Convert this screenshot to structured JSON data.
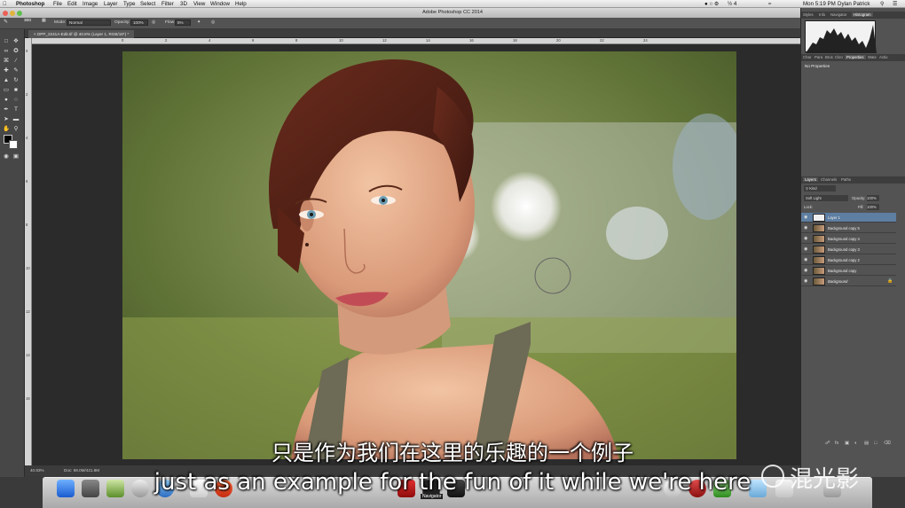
{
  "menubar": {
    "app_name": "Photoshop",
    "items": [
      "File",
      "Edit",
      "Image",
      "Layer",
      "Type",
      "Select",
      "Filter",
      "3D",
      "View",
      "Window",
      "Help"
    ],
    "battery": "½ 4",
    "clock": "Mon 5:19 PM",
    "user": "Dylan Patrick"
  },
  "window": {
    "title": "Adobe Photoshop CC 2014"
  },
  "options": {
    "brush_size": "300",
    "mode_label": "Mode:",
    "mode_value": "Normal",
    "opacity_label": "Opacity:",
    "opacity_value": "100%",
    "flow_label": "Flow:",
    "flow_value": "5%"
  },
  "document": {
    "tab_label": "DPP_2241A-Edit.tif @ 40.8% (Layer 1, RGB/16*) *",
    "zoom": "40.83%",
    "doc_size": "Doc: 69.0M/421.8M"
  },
  "ruler": {
    "top": [
      "0",
      "2",
      "4",
      "6",
      "8",
      "10",
      "12",
      "14",
      "16",
      "18",
      "20",
      "22",
      "24"
    ],
    "left": [
      "0",
      "2",
      "4",
      "6",
      "8",
      "10",
      "12",
      "14",
      "16"
    ]
  },
  "panels": {
    "top_tabs": [
      "Styles",
      "Info",
      "Navigator",
      "Histogram"
    ],
    "mid_tabs": [
      "Char",
      "Para",
      "Brus",
      "Clon",
      "Properties",
      "Wate",
      "Actio"
    ],
    "no_properties": "No Properties",
    "layers_tabs": [
      "Layers",
      "Channels",
      "Paths"
    ],
    "kind_label": "Kind",
    "blend_mode": "Soft Light",
    "opacity_label": "Opacity:",
    "opacity_value": "100%",
    "lock_label": "Lock:",
    "fill_label": "Fill:",
    "fill_value": "100%",
    "layers": [
      {
        "name": "Layer 1",
        "selected": true
      },
      {
        "name": "Background copy 5",
        "selected": false
      },
      {
        "name": "Background copy 4",
        "selected": false
      },
      {
        "name": "Background copy 3",
        "selected": false
      },
      {
        "name": "Background copy 2",
        "selected": false
      },
      {
        "name": "Background copy",
        "selected": false
      },
      {
        "name": "Background",
        "selected": false
      }
    ]
  },
  "dock": {
    "label": "Navigator"
  },
  "subtitles": {
    "chinese": "只是作为我们在这里的乐趣的一个例子",
    "english": "just as an example for the fun of it while we're here"
  },
  "watermark": {
    "text": "混光影"
  }
}
